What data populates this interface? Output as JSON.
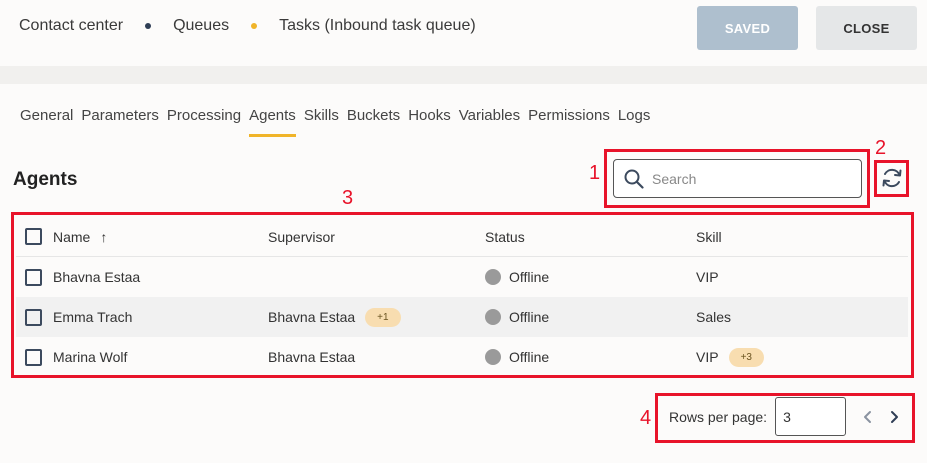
{
  "breadcrumb": {
    "items": [
      "Contact center",
      "Queues",
      "Tasks (Inbound task queue)"
    ],
    "dot_colors": [
      "#2f3e55",
      "#f0b429"
    ]
  },
  "header": {
    "saved_label": "SAVED",
    "close_label": "CLOSE"
  },
  "tabs": [
    "General",
    "Parameters",
    "Processing",
    "Agents",
    "Skills",
    "Buckets",
    "Hooks",
    "Variables",
    "Permissions",
    "Logs"
  ],
  "active_tab": "Agents",
  "section_title": "Agents",
  "search": {
    "placeholder": "Search"
  },
  "table": {
    "columns": [
      "Name",
      "Supervisor",
      "Status",
      "Skill"
    ],
    "sort_indicator": "↑",
    "rows": [
      {
        "name": "Bhavna Estaa",
        "supervisor": "",
        "supervisor_badge": "",
        "status": "Offline",
        "skill": "VIP",
        "skill_badge": ""
      },
      {
        "name": "Emma Trach",
        "supervisor": "Bhavna Estaa",
        "supervisor_badge": "+1",
        "status": "Offline",
        "skill": "Sales",
        "skill_badge": ""
      },
      {
        "name": "Marina Wolf",
        "supervisor": "Bhavna Estaa",
        "supervisor_badge": "",
        "status": "Offline",
        "skill": "VIP",
        "skill_badge": "+3"
      }
    ]
  },
  "pagination": {
    "rows_per_page_label": "Rows per page:",
    "rows_per_page_value": "3"
  },
  "annotations": [
    "1",
    "2",
    "3",
    "4"
  ],
  "colors": {
    "accent": "#f0b429",
    "annotation": "#e8132a",
    "saved_button": "#aebfce"
  }
}
